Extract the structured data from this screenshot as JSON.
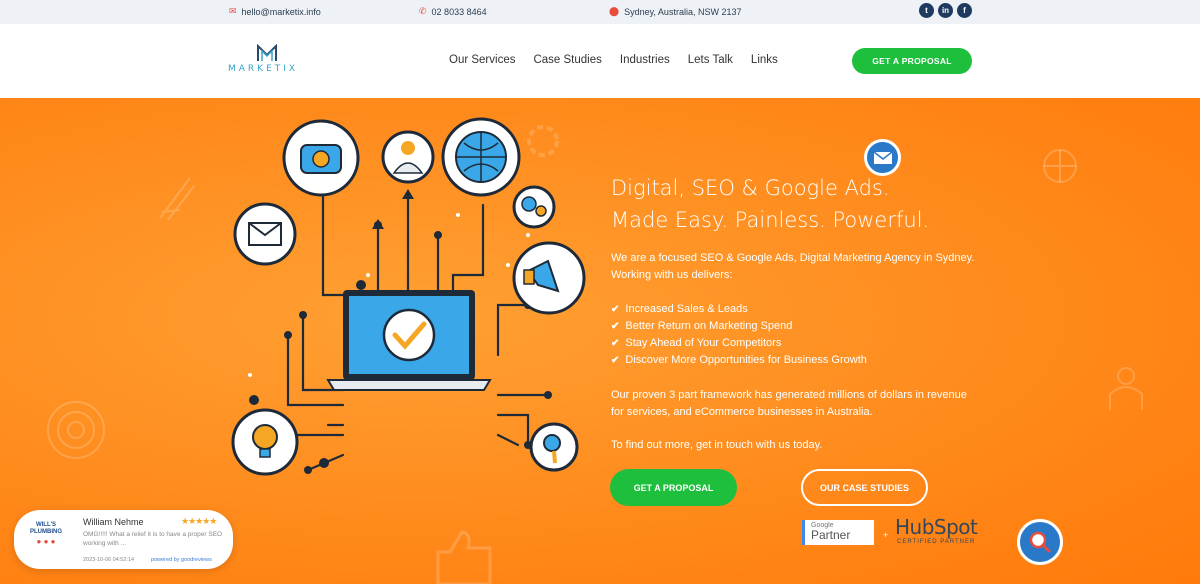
{
  "topbar": {
    "email": "hello@marketix.info",
    "phone": "02 8033 8464",
    "location": "Sydney, Australia, NSW 2137",
    "social": [
      "twitter",
      "linkedin",
      "facebook"
    ]
  },
  "header": {
    "logo_text": "MARKETIX",
    "nav": [
      "Our Services",
      "Case Studies",
      "Industries",
      "Lets Talk",
      "Links"
    ],
    "cta": "GET A PROPOSAL"
  },
  "hero": {
    "headline_1": "Digital, SEO & Google Ads.",
    "headline_2": "Made Easy. Painless. Powerful.",
    "intro": "We are a focused SEO & Google Ads, Digital Marketing Agency in Sydney. Working with us delivers:",
    "bullets": [
      "Increased Sales & Leads",
      "Better Return on Marketing Spend",
      "Stay Ahead of Your Competitors",
      "Discover More Opportunities for Business Growth"
    ],
    "para2": "Our proven 3 part framework has generated millions of dollars in revenue for services, and eCommerce businesses in Australia.",
    "para3": "To find out more, get in touch with us today.",
    "btn_proposal": "GET A PROPOSAL",
    "btn_case": "OUR CASE STUDIES"
  },
  "badges": {
    "google_top": "Google",
    "google_bottom": "Partner",
    "plus": "+",
    "hubspot": "HubSpot",
    "hubspot_sub": "CERTIFIED PARTNER"
  },
  "review": {
    "logo_text": "WILL'S PLUMBING",
    "name": "William Nehme",
    "stars": "★★★★★",
    "text": "OMG!!!!! What a relief it is to have a proper SEO working with ...",
    "date": "2023-10-06 04:52:14",
    "powered": "powered by goodreviews"
  },
  "colors": {
    "accent_green": "#1fbf3e",
    "hero_orange": "#ff8c1a",
    "icon_blue": "#2a79c8",
    "logo_teal": "#3ba4c8"
  }
}
